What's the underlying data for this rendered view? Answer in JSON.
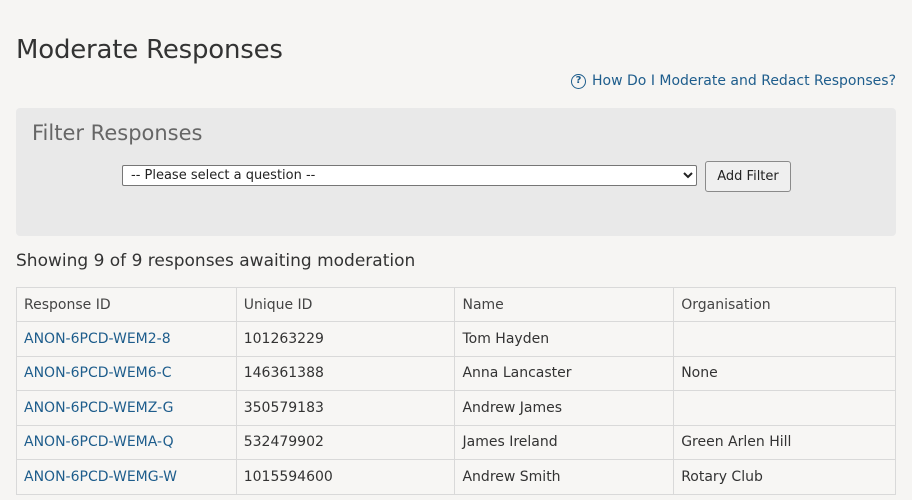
{
  "page": {
    "title": "Moderate Responses",
    "help_link": "How Do I Moderate and Redact Responses?"
  },
  "filter": {
    "title": "Filter Responses",
    "select_value": "-- Please select a question --",
    "add_button": "Add Filter"
  },
  "summary": "Showing 9 of 9 responses awaiting moderation",
  "table": {
    "headers": [
      "Response ID",
      "Unique ID",
      "Name",
      "Organisation"
    ],
    "rows": [
      {
        "response_id": "ANON-6PCD-WEM2-8",
        "unique_id": "101263229",
        "name": "Tom Hayden",
        "organisation": ""
      },
      {
        "response_id": "ANON-6PCD-WEM6-C",
        "unique_id": "146361388",
        "name": "Anna Lancaster",
        "organisation": "None"
      },
      {
        "response_id": "ANON-6PCD-WEMZ-G",
        "unique_id": "350579183",
        "name": "Andrew James",
        "organisation": ""
      },
      {
        "response_id": "ANON-6PCD-WEMA-Q",
        "unique_id": "532479902",
        "name": "James Ireland",
        "organisation": "Green Arlen Hill"
      },
      {
        "response_id": "ANON-6PCD-WEMG-W",
        "unique_id": "1015594600",
        "name": "Andrew Smith",
        "organisation": "Rotary Club"
      }
    ]
  },
  "colors": {
    "link": "#1e5d8c",
    "background": "#f6f5f3",
    "panel": "#e9e9e9"
  },
  "icons": {
    "help": "question-circle-icon"
  }
}
